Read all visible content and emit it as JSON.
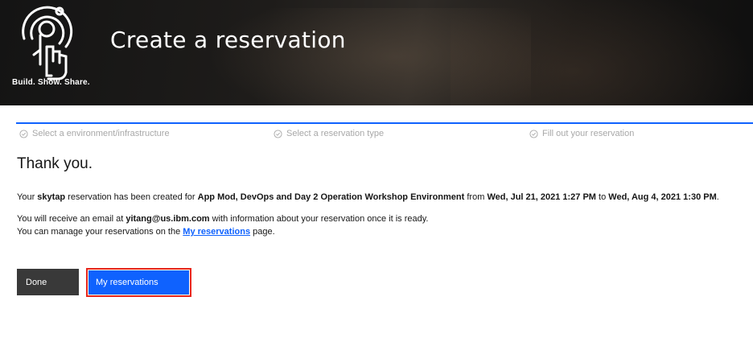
{
  "banner": {
    "logo_text": "Build. Show. Share.",
    "title": "Create a reservation"
  },
  "steps": [
    {
      "label": "Select a environment/infrastructure"
    },
    {
      "label": "Select a reservation type"
    },
    {
      "label": "Fill out your reservation"
    }
  ],
  "content": {
    "heading": "Thank you.",
    "line1": {
      "t1": "Your ",
      "provider": "skytap",
      "t2": " reservation has been created for ",
      "environment": "App Mod, DevOps and Day 2 Operation Workshop Environment",
      "t3": " from ",
      "start": "Wed, Jul 21, 2021 1:27 PM",
      "t4": " to ",
      "end": "Wed, Aug 4, 2021 1:30 PM",
      "t5": "."
    },
    "line2": {
      "t1": "You will receive an email at ",
      "email": "yitang@us.ibm.com",
      "t2": " with information about your reservation once it is ready."
    },
    "line3": {
      "t1": "You can manage your reservations on the ",
      "link": "My reservations",
      "t2": " page."
    }
  },
  "buttons": {
    "done": "Done",
    "my_reservations": "My reservations"
  },
  "colors": {
    "accent": "#0f62fe",
    "done_bg": "#393939",
    "highlight_border": "#e8261b"
  }
}
